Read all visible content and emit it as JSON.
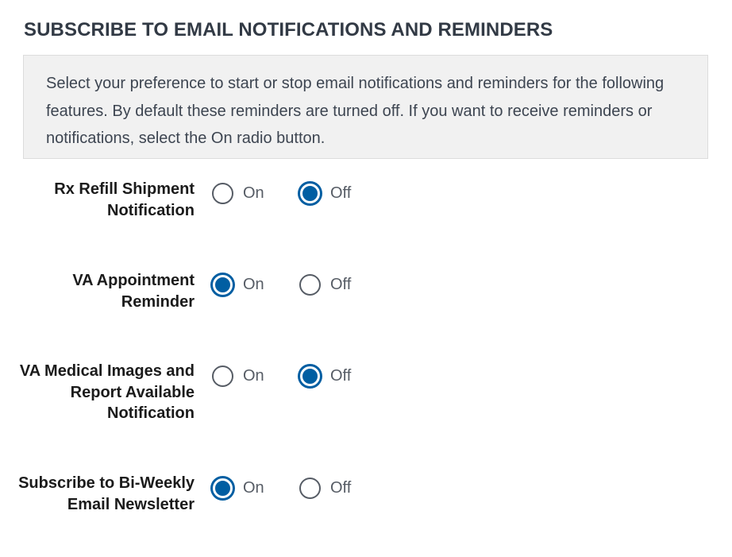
{
  "page": {
    "title": "SUBSCRIBE TO EMAIL NOTIFICATIONS AND REMINDERS",
    "description": "Select your preference to start or stop email notifications and reminders for the following features. By default these reminders are turned off. If you want to receive reminders or notifications, select the On radio button."
  },
  "colors": {
    "accent": "#005ea2",
    "info_box_background": "#f1f1f1",
    "title": "#323a45"
  },
  "option_labels": {
    "on": "On",
    "off": "Off"
  },
  "preferences": [
    {
      "label": "Rx Refill Shipment Notification",
      "selected": "Off"
    },
    {
      "label": "VA Appointment Reminder",
      "selected": "On"
    },
    {
      "label": "VA Medical Images and Report Available Notification",
      "selected": "Off"
    },
    {
      "label": "Subscribe to Bi-Weekly Email Newsletter",
      "selected": "On"
    }
  ]
}
